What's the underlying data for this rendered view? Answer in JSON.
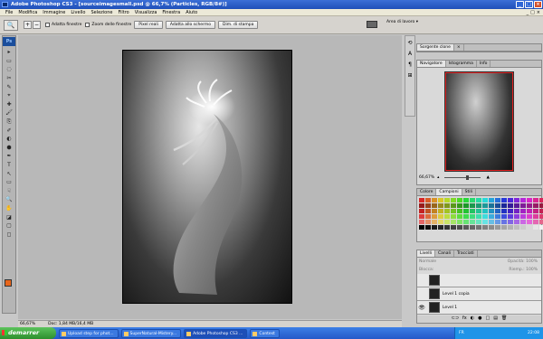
{
  "window": {
    "title": "Adobe Photoshop CS3 - [sourceimagesmall.psd @ 66,7% (Particles, RGB/8#)]",
    "buttons": [
      "_",
      "□",
      "×"
    ]
  },
  "menu": {
    "items": [
      "File",
      "Modifica",
      "Immagine",
      "Livello",
      "Selezione",
      "Filtro",
      "Visualizza",
      "Finestra",
      "Aiuto"
    ],
    "mdi_buttons": [
      "_",
      "□",
      "×"
    ]
  },
  "options": {
    "tool_icon": "🔍",
    "zoom_in": "+",
    "zoom_out": "−",
    "check1": "Adatta finestre",
    "check2": "Zoom delle finestre",
    "btn_pixel": "Pixel reali",
    "btn_fit": "Adatta allo schermo",
    "btn_print": "Dim. di stampa",
    "workspace": "Area di lavoro ▾"
  },
  "tools": {
    "logo": "Ps",
    "icons": [
      "▸",
      "▭",
      "◌",
      "✂",
      "✎",
      "⌖",
      "✚",
      "🖌",
      "⎘",
      "✐",
      "◐",
      "⬢",
      "✒",
      "T",
      "↖",
      "▭",
      "☟",
      "🔍",
      "✋",
      "◪",
      "▢",
      "◻"
    ]
  },
  "document": {
    "zoom": "66,67%",
    "doc_info": "Doc: 1,84 MB/16,4 MB"
  },
  "dock": {
    "icons": [
      "⟲",
      "A",
      "¶",
      "⊞"
    ]
  },
  "panels": {
    "source": {
      "tab": "Sorgente clone",
      "close": "×"
    },
    "navigator": {
      "tabs": [
        "Navigatore",
        "Istogramma",
        "Info"
      ],
      "zoom": "66,67%"
    },
    "color": {
      "tabs": [
        "Colore",
        "Campioni",
        "Stili"
      ]
    },
    "layers": {
      "tabs": [
        "Livelli",
        "Canali",
        "Tracciati"
      ],
      "mode": "Normale",
      "opacity_label": "Opacità:",
      "opacity": "100%",
      "lock_label": "Blocca:",
      "fill_label": "Riemp.:",
      "fill": "100%",
      "rows": [
        {
          "name": "",
          "visible": false
        },
        {
          "name": "Level 1 copia",
          "visible": false
        },
        {
          "name": "Level 1",
          "visible": true
        }
      ],
      "footer": [
        "⊂⊃",
        "fx",
        "◐",
        "●",
        "□",
        "▤",
        "🗑"
      ]
    }
  },
  "taskbar": {
    "start": "demarrer",
    "tasks": [
      "Upload step for phot...",
      "SuperNatural-Mistery...",
      "Adobe Photoshop CS3 ...",
      "Contest"
    ],
    "active_index": 2,
    "lang": "FR",
    "clock": "22:08"
  },
  "colors": {
    "accent": "#1f4fb8",
    "foreground": "#e8661c",
    "background": "#ffffff",
    "navigator_proxy": "#e02020"
  }
}
